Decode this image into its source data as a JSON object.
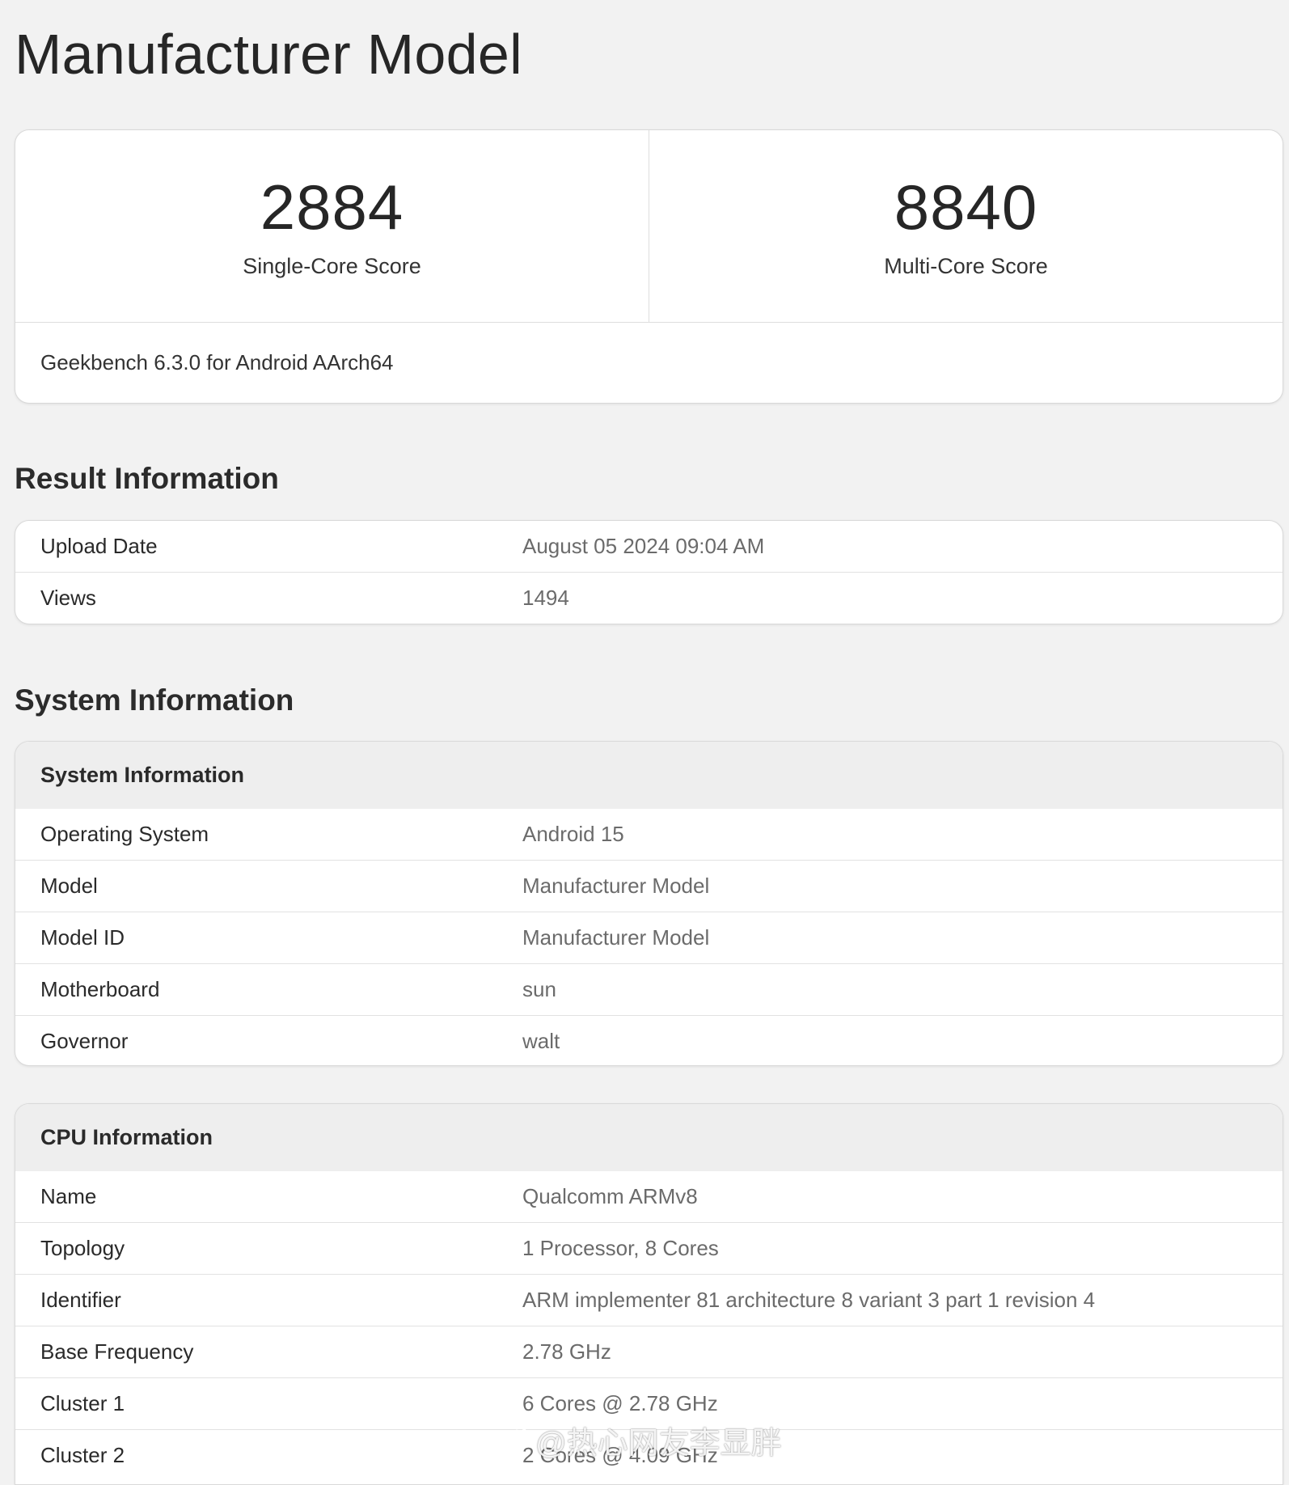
{
  "page": {
    "title": "Manufacturer Model"
  },
  "scores": {
    "single_core": {
      "value": "2884",
      "label": "Single-Core Score"
    },
    "multi_core": {
      "value": "8840",
      "label": "Multi-Core Score"
    },
    "version": "Geekbench 6.3.0 for Android AArch64"
  },
  "result_info": {
    "title": "Result Information",
    "rows": [
      {
        "key": "Upload Date",
        "value": "August 05 2024 09:04 AM"
      },
      {
        "key": "Views",
        "value": "1494"
      }
    ]
  },
  "system_info": {
    "title": "System Information",
    "header": "System Information",
    "rows": [
      {
        "key": "Operating System",
        "value": "Android 15"
      },
      {
        "key": "Model",
        "value": "Manufacturer Model"
      },
      {
        "key": "Model ID",
        "value": "Manufacturer Model"
      },
      {
        "key": "Motherboard",
        "value": "sun"
      },
      {
        "key": "Governor",
        "value": "walt"
      }
    ]
  },
  "cpu_info": {
    "header": "CPU Information",
    "rows": [
      {
        "key": "Name",
        "value": "Qualcomm ARMv8"
      },
      {
        "key": "Topology",
        "value": "1 Processor, 8 Cores"
      },
      {
        "key": "Identifier",
        "value": "ARM implementer 81 architecture 8 variant 3 part 1 revision 4"
      },
      {
        "key": "Base Frequency",
        "value": "2.78 GHz"
      },
      {
        "key": "Cluster 1",
        "value": "6 Cores @ 2.78 GHz"
      },
      {
        "key": "Cluster 2",
        "value": "2 Cores @ 4.09 GHz"
      }
    ]
  },
  "watermark": {
    "icon": "weibo-logo-icon",
    "text": "@热心网友李显胖"
  },
  "colors": {
    "background": "#f2f2f2",
    "card": "#ffffff",
    "header_bg": "#eeeeee",
    "value_text": "#6b6b6b"
  }
}
